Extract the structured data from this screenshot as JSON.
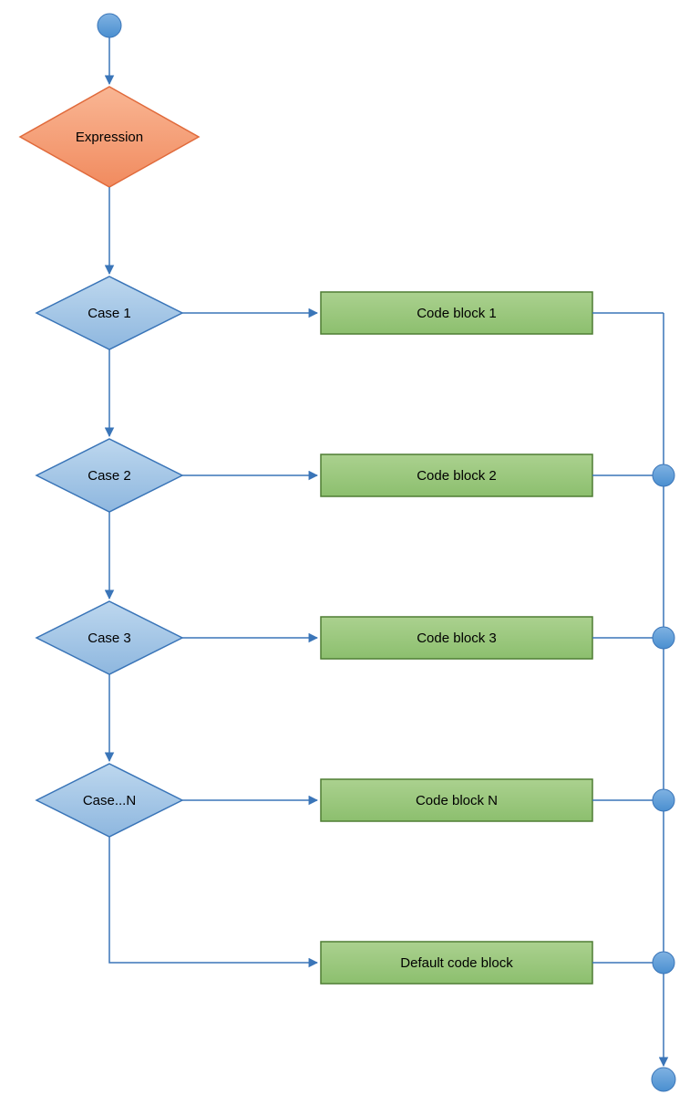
{
  "colors": {
    "blue_stroke": "#3a75b8",
    "blue_fill_light": "#9cc2e5",
    "blue_fill_dark": "#5b9bd5",
    "orange_fill": "#f4a079",
    "orange_stroke": "#e06a3b",
    "green_fill": "#93c47d",
    "green_stroke": "#4f7d33"
  },
  "nodes": {
    "expression": "Expression",
    "case1": "Case 1",
    "case2": "Case 2",
    "case3": "Case 3",
    "caseN": "Case...N",
    "code1": "Code block 1",
    "code2": "Code block 2",
    "code3": "Code block 3",
    "codeN": "Code block N",
    "default": "Default code block"
  }
}
